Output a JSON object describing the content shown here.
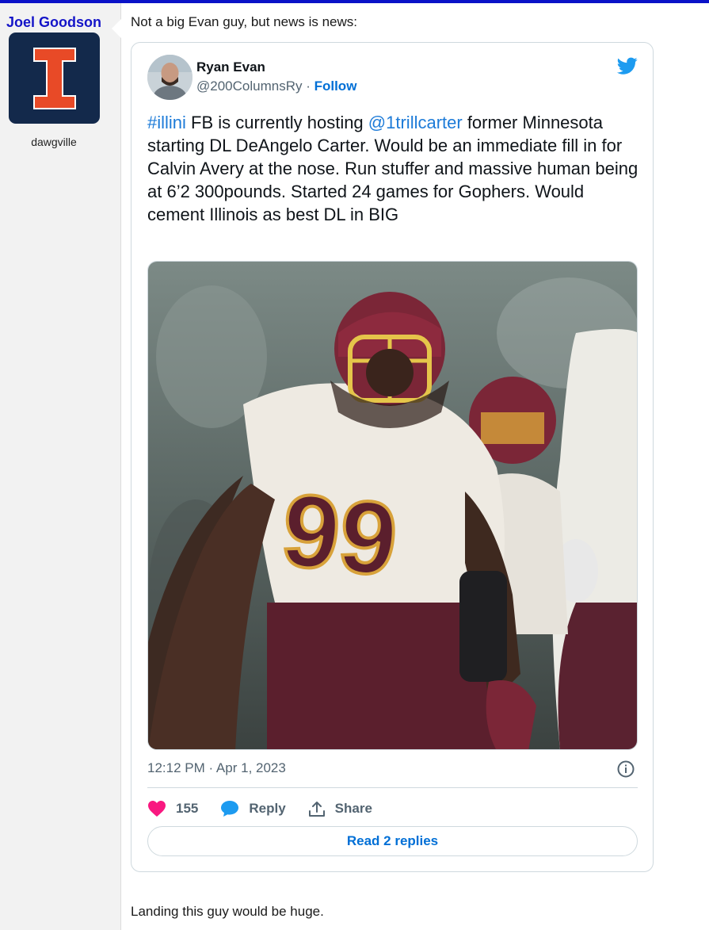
{
  "author": {
    "username": "Joel Goodson",
    "location": "dawgville",
    "avatar_icon": "illinois-block-i-logo",
    "avatar_bg": "#13294b",
    "avatar_fg": "#e84a27"
  },
  "post": {
    "intro": "Not a big Evan guy, but news is news:",
    "outro": "Landing this guy would be huge."
  },
  "tweet": {
    "name": "Ryan Evan",
    "handle": "@200ColumnsRy",
    "separator": " · ",
    "follow_label": "Follow",
    "hashtag": "#illini",
    "text_1": " FB is currently hosting ",
    "mention": "@1trillcarter",
    "text_2": " former Minnesota starting DL DeAngelo Carter. Would be an immediate fill in for Calvin Avery at the nose. Run stuffer and massive human being at 6’2 300pounds. Started 24 games for Gophers. Would cement Illinois as best DL in BIG",
    "timestamp": "12:12 PM · Apr 1, 2023",
    "likes": "155",
    "reply_label": "Reply",
    "share_label": "Share",
    "read_replies_label": "Read 2 replies",
    "icons": {
      "bird": "twitter-bird-icon",
      "info": "info-icon",
      "like": "heart-icon",
      "reply": "speech-bubble-icon",
      "share": "share-upload-icon"
    },
    "colors": {
      "twitter_blue": "#1d9bf0",
      "link": "#1d7bd8",
      "like": "#f91880",
      "follow": "#006fd6"
    }
  }
}
